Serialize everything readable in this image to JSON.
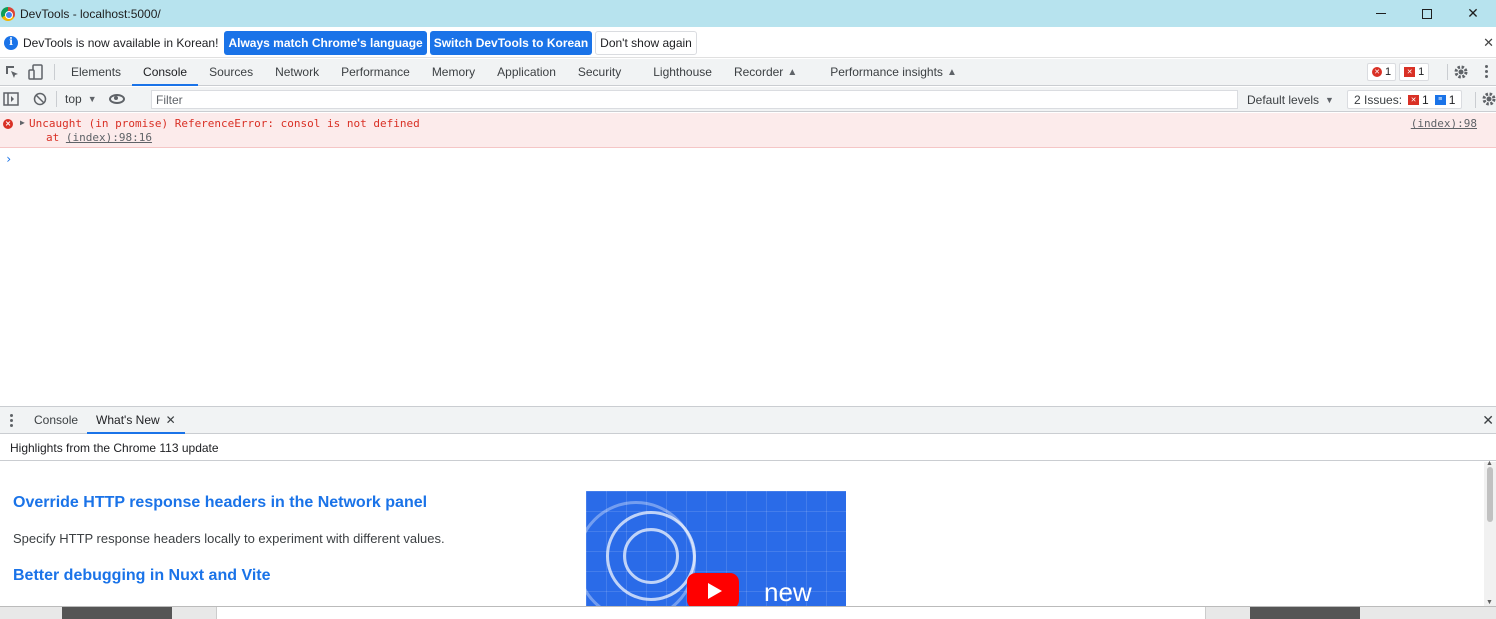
{
  "window": {
    "title": "DevTools - localhost:5000/",
    "minimize_icon": "minimize-icon",
    "maximize_icon": "maximize-icon",
    "close_glyph": "✕"
  },
  "infobar": {
    "message": "DevTools is now available in Korean!",
    "btn_match": "Always match Chrome's language",
    "btn_switch": "Switch DevTools to Korean",
    "btn_dismiss": "Don't show again",
    "close_glyph": "✕"
  },
  "tabs": {
    "items": [
      "Elements",
      "Console",
      "Sources",
      "Network",
      "Performance",
      "Memory",
      "Application",
      "Security",
      "Lighthouse",
      "Recorder",
      "Performance insights"
    ],
    "active": "Console",
    "error_count": "1",
    "issue_count": "1",
    "colors": {
      "accent": "#1a73e8",
      "error": "#d93025",
      "toolbar_bg": "#f1f3f4"
    }
  },
  "console_toolbar": {
    "context": "top",
    "filter_placeholder": "Filter",
    "levels": "Default levels",
    "issues_label": "2 Issues:",
    "issues_errors": "1",
    "issues_info": "1"
  },
  "messages": [
    {
      "level": "error",
      "text": "Uncaught (in promise) ReferenceError: consol is not defined",
      "at_prefix": "at ",
      "at_link": "(index):98:16",
      "source": "(index):98"
    }
  ],
  "prompt_glyph": "›",
  "drawer": {
    "tabs": [
      "Console",
      "What's New"
    ],
    "active": "What's New",
    "tab_close_glyph": "✕",
    "close_glyph": "✕",
    "header": "Highlights from the Chrome 113 update",
    "articles": [
      {
        "title": "Override HTTP response headers in the Network panel",
        "desc": "Specify HTTP response headers locally to experiment with different values."
      },
      {
        "title": "Better debugging in Nuxt and Vite",
        "desc": ""
      }
    ],
    "video_label": "new"
  }
}
